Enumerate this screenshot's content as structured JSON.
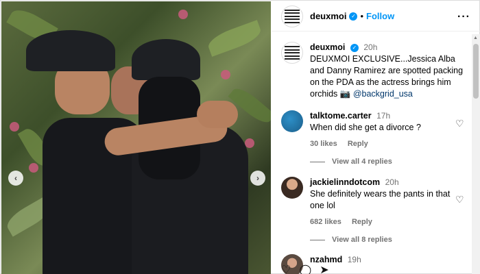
{
  "post": {
    "username": "deuxmoi",
    "follow_label": "Follow",
    "separator": "•",
    "more_label": "···"
  },
  "caption": {
    "username": "deuxmoi",
    "time": "20h",
    "text": "DEUXMOI EXCLUSIVE...Jessica Alba and Danny Ramirez are spotted packing on the PDA as the actress brings him orchids 📷",
    "mention": "@backgrid_usa"
  },
  "comments": [
    {
      "username": "talktome.carter",
      "time": "17h",
      "text": "When did she get a divorce ?",
      "likes": "30 likes",
      "reply_label": "Reply",
      "view_replies": "View all 4 replies"
    },
    {
      "username": "jackielinndotcom",
      "time": "20h",
      "text": "She definitely wears the pants in that one lol",
      "likes": "682 likes",
      "reply_label": "Reply",
      "view_replies": "View all 8 replies"
    },
    {
      "username": "nzahmd",
      "time": "19h"
    }
  ],
  "icons": {
    "heart": "heart-icon",
    "prev": "chevron-left-icon",
    "next": "chevron-right-icon",
    "verified": "verified-badge-icon",
    "more": "more-options-icon"
  },
  "colors": {
    "accent": "#0095f6",
    "link": "#00376b",
    "muted": "#737373"
  }
}
